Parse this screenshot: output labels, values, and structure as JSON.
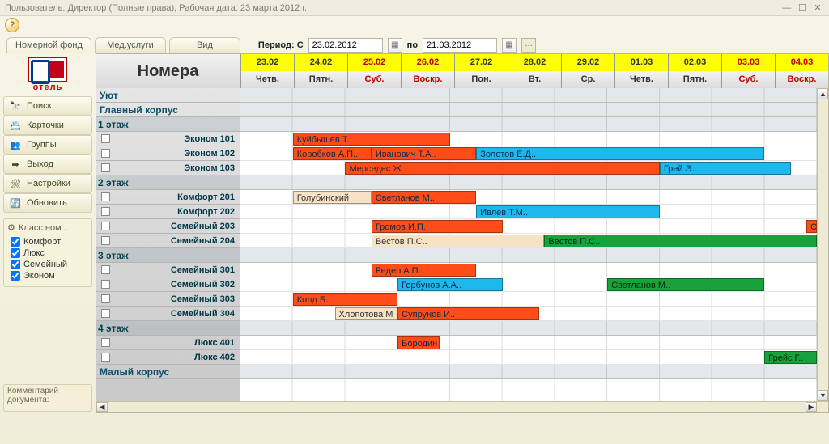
{
  "titlebar": "Пользователь: Директор (Полные права), Рабочая дата: 23 марта 2012 г.",
  "tabs": [
    "Номерной фонд",
    "Мед.услуги",
    "Вид"
  ],
  "period": {
    "label_prefix": "Период:",
    "label_from": "С",
    "from": "23.02.2012",
    "label_to": "по",
    "to": "21.03.2012"
  },
  "logo_text": "отель",
  "side_buttons": [
    {
      "icon": "🔭",
      "label": "Поиск",
      "name": "search-button"
    },
    {
      "icon": "📇",
      "label": "Карточки",
      "name": "cards-button"
    },
    {
      "icon": "👥",
      "label": "Группы",
      "name": "groups-button"
    },
    {
      "icon": "➡",
      "label": "Выход",
      "name": "exit-button"
    },
    {
      "icon": "🛠",
      "label": "Настройки",
      "name": "settings-button"
    },
    {
      "icon": "🔄",
      "label": "Обновить",
      "name": "refresh-button"
    }
  ],
  "filters": {
    "header": "Класс ном...",
    "items": [
      "Комфорт",
      "Люкс",
      "Семейный",
      "Эконом"
    ]
  },
  "comment_label": "Комментарий документа:",
  "rooms_header": "Номера",
  "dates": [
    {
      "d": "23.02",
      "w": "Четв.",
      "we": false
    },
    {
      "d": "24.02",
      "w": "Пятн.",
      "we": false
    },
    {
      "d": "25.02",
      "w": "Суб.",
      "we": true
    },
    {
      "d": "26.02",
      "w": "Воскр.",
      "we": true
    },
    {
      "d": "27.02",
      "w": "Пон.",
      "we": false
    },
    {
      "d": "28.02",
      "w": "Вт.",
      "we": false
    },
    {
      "d": "29.02",
      "w": "Ср.",
      "we": false
    },
    {
      "d": "01.03",
      "w": "Четв.",
      "we": false
    },
    {
      "d": "02.03",
      "w": "Пятн.",
      "we": false
    },
    {
      "d": "03.03",
      "w": "Суб.",
      "we": true
    },
    {
      "d": "04.03",
      "w": "Воскр.",
      "we": true
    }
  ],
  "rows": [
    {
      "type": "section",
      "label": "Уют"
    },
    {
      "type": "section",
      "label": "Главный корпус"
    },
    {
      "type": "group",
      "label": "1 этаж"
    },
    {
      "type": "room",
      "label": "Эконом 101",
      "bars": [
        {
          "s": 1,
          "e": 4,
          "c": "orange",
          "t": "Куйбышев Т.."
        }
      ]
    },
    {
      "type": "room",
      "label": "Эконом 102",
      "bars": [
        {
          "s": 1,
          "e": 2.5,
          "c": "orange",
          "t": "Коробков А.П.."
        },
        {
          "s": 2.5,
          "e": 4.5,
          "c": "orange",
          "t": "Иванович Т.А.."
        },
        {
          "s": 4.5,
          "e": 10,
          "c": "blue",
          "t": "Золотов Е.Д.."
        }
      ]
    },
    {
      "type": "room",
      "label": "Эконом 103",
      "bars": [
        {
          "s": 2,
          "e": 8,
          "c": "orange",
          "t": "Мерседес Ж.."
        },
        {
          "s": 8,
          "e": 10.5,
          "c": "blue",
          "t": "Грей Э…"
        }
      ]
    },
    {
      "type": "group",
      "label": "2 этаж"
    },
    {
      "type": "room",
      "label": "Комфорт 201",
      "bars": [
        {
          "s": 1,
          "e": 2.5,
          "c": "beige",
          "t": "Голубинский"
        },
        {
          "s": 2.5,
          "e": 4.5,
          "c": "orange",
          "t": "Светланов М.."
        }
      ]
    },
    {
      "type": "room",
      "label": "Комфорт 202",
      "bars": [
        {
          "s": 4.5,
          "e": 8,
          "c": "blue",
          "t": "Ивлев Т.М.."
        }
      ]
    },
    {
      "type": "room",
      "label": "Семейный 203",
      "bars": [
        {
          "s": 2.5,
          "e": 5,
          "c": "orange",
          "t": "Громов И.П.."
        },
        {
          "s": 10.8,
          "e": 11,
          "c": "orange",
          "t": "Со"
        }
      ]
    },
    {
      "type": "room",
      "label": "Семейный 204",
      "bars": [
        {
          "s": 2.5,
          "e": 5.8,
          "c": "beige",
          "t": "Вестов П.С.."
        },
        {
          "s": 5.8,
          "e": 11,
          "c": "green",
          "t": "Вестов П.С.."
        }
      ]
    },
    {
      "type": "group",
      "label": "3 этаж"
    },
    {
      "type": "room",
      "label": "Семейный 301",
      "bars": [
        {
          "s": 2.5,
          "e": 4.5,
          "c": "orange",
          "t": "Редер А.П.."
        }
      ]
    },
    {
      "type": "room",
      "label": "Семейный 302",
      "bars": [
        {
          "s": 3,
          "e": 5,
          "c": "blue",
          "t": "Горбунов А.А.."
        },
        {
          "s": 7,
          "e": 10,
          "c": "green",
          "t": "Светланов М.."
        }
      ]
    },
    {
      "type": "room",
      "label": "Семейный 303",
      "bars": [
        {
          "s": 1,
          "e": 3,
          "c": "orange",
          "t": "Колд Б.."
        }
      ]
    },
    {
      "type": "room",
      "label": "Семейный 304",
      "bars": [
        {
          "s": 1.8,
          "e": 3,
          "c": "beige",
          "t": "Хлопотова М"
        },
        {
          "s": 3,
          "e": 5.7,
          "c": "orange",
          "t": "Супрунов И.."
        }
      ]
    },
    {
      "type": "group",
      "label": "4 этаж"
    },
    {
      "type": "room",
      "label": "Люкс 401",
      "bars": [
        {
          "s": 3,
          "e": 3.8,
          "c": "orange",
          "t": "Бородин"
        }
      ]
    },
    {
      "type": "room",
      "label": "Люкс 402",
      "bars": [
        {
          "s": 10,
          "e": 11,
          "c": "green",
          "t": "Грейс Г.."
        }
      ]
    },
    {
      "type": "section",
      "label": "Малый корпус"
    }
  ]
}
